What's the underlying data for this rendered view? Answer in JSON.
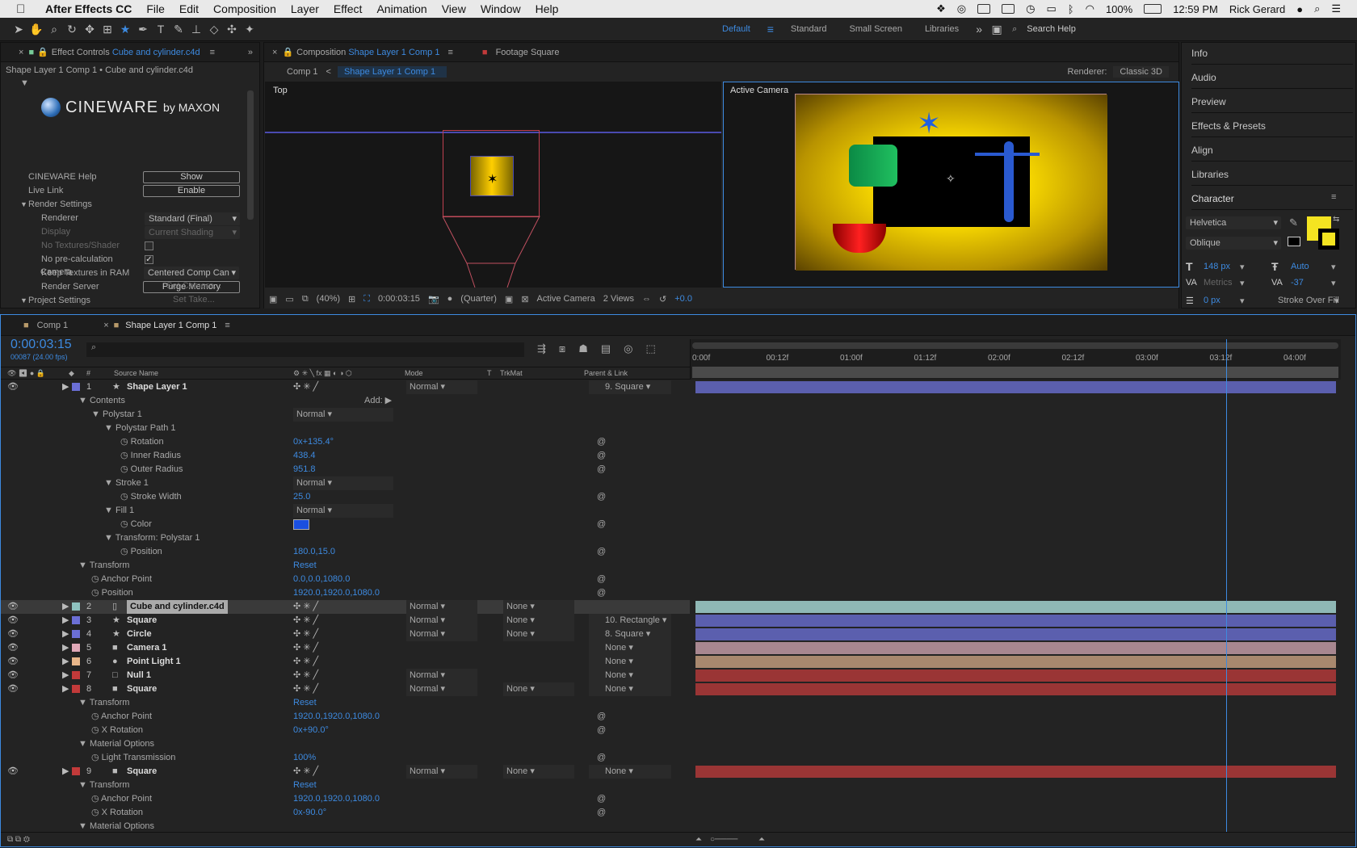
{
  "menubar": {
    "app_name": "After Effects CC",
    "items": [
      "File",
      "Edit",
      "Composition",
      "Layer",
      "Effect",
      "Animation",
      "View",
      "Window",
      "Help"
    ],
    "battery": "100%",
    "clock": "12:59 PM",
    "user": "Rick Gerard"
  },
  "toolbar": {
    "workspaces": [
      "Default",
      "Standard",
      "Small Screen",
      "Libraries"
    ],
    "active_workspace": "Default",
    "search_placeholder": "Search Help"
  },
  "effect_controls": {
    "tab_prefix": "Effect Controls",
    "tab_target": "Cube and cylinder.c4d",
    "breadcrumb": "Shape Layer 1 Comp 1 • Cube and cylinder.c4d",
    "brand": "CINEWARE",
    "brand_by": "by MAXON",
    "rows": {
      "help_label": "CINEWARE Help",
      "help_btn": "Show",
      "live_label": "Live Link",
      "live_btn": "Enable",
      "render_settings": "Render Settings",
      "renderer_label": "Renderer",
      "renderer_val": "Standard (Final)",
      "display_label": "Display",
      "display_val": "Current Shading",
      "no_tex_label": "No Textures/Shader",
      "no_precalc_label": "No pre-calculation",
      "keep_tex_label": "Keep Textures in RAM",
      "render_server_label": "Render Server",
      "render_server_btn": "Purge Memory",
      "project_settings": "Project Settings",
      "camera_label": "Camera",
      "camera_val": "Centered Comp Can",
      "set_camera": "Set Camera...",
      "set_take": "Set Take..."
    }
  },
  "composition": {
    "tab_prefix": "Composition",
    "tab_name": "Shape Layer 1 Comp 1",
    "footage_tab": "Footage Square",
    "crumb_1": "Comp 1",
    "crumb_2": "Shape Layer 1 Comp 1",
    "renderer_label": "Renderer:",
    "renderer_val": "Classic 3D",
    "view_left": "Top",
    "view_right": "Active Camera",
    "zoom": "(40%)",
    "timecode": "0:00:03:15",
    "resolution": "(Quarter)",
    "camera": "Active Camera",
    "views": "2 Views",
    "exposure": "+0.0"
  },
  "right_panel": {
    "items": [
      "Info",
      "Audio",
      "Preview",
      "Effects & Presets",
      "Align",
      "Libraries"
    ],
    "character": {
      "title": "Character",
      "font": "Helvetica",
      "style": "Oblique",
      "size": "148 px",
      "leading": "Auto",
      "kerning": "Metrics",
      "tracking": "-37",
      "stroke": "0 px",
      "stroke_mode": "Stroke Over Fill"
    }
  },
  "timeline": {
    "tabs": [
      "Comp 1",
      "Shape Layer 1 Comp 1"
    ],
    "timecode": "0:00:03:15",
    "frames": "00087 (24.00 fps)",
    "columns": {
      "hash": "#",
      "source": "Source Name",
      "mode": "Mode",
      "t": "T",
      "trkmat": "TrkMat",
      "parent": "Parent & Link"
    },
    "ruler": [
      "0:00f",
      "00:12f",
      "01:00f",
      "01:12f",
      "02:00f",
      "02:12f",
      "03:00f",
      "03:12f",
      "04:00f"
    ],
    "playhead_fraction": 0.828,
    "rows": [
      {
        "kind": "layer",
        "num": "1",
        "name": "Shape Layer 1",
        "color": "#6b6fd6",
        "mode": "Normal",
        "parent": "9. Square",
        "icon": "★",
        "bar": "#5b5fae"
      },
      {
        "kind": "group",
        "indent": 1,
        "name": "Contents",
        "extra": "Add:"
      },
      {
        "kind": "group",
        "indent": 2,
        "name": "Polystar 1",
        "mode": "Normal"
      },
      {
        "kind": "group",
        "indent": 3,
        "name": "Polystar Path 1"
      },
      {
        "kind": "prop",
        "indent": 4,
        "name": "Rotation",
        "value": "0x+135.4°"
      },
      {
        "kind": "prop",
        "indent": 4,
        "name": "Inner Radius",
        "value": "438.4"
      },
      {
        "kind": "prop",
        "indent": 4,
        "name": "Outer Radius",
        "value": "951.8"
      },
      {
        "kind": "group",
        "indent": 3,
        "name": "Stroke 1",
        "mode": "Normal"
      },
      {
        "kind": "prop",
        "indent": 4,
        "name": "Stroke Width",
        "value": "25.0"
      },
      {
        "kind": "group",
        "indent": 3,
        "name": "Fill 1",
        "mode": "Normal"
      },
      {
        "kind": "prop",
        "indent": 4,
        "name": "Color",
        "value": ""
      },
      {
        "kind": "group",
        "indent": 3,
        "name": "Transform: Polystar 1"
      },
      {
        "kind": "prop",
        "indent": 4,
        "name": "Position",
        "value": "180.0,15.0"
      },
      {
        "kind": "group",
        "indent": 1,
        "name": "Transform",
        "value": "Reset"
      },
      {
        "kind": "prop",
        "indent": 2,
        "name": "Anchor Point",
        "value": "0.0,0.0,1080.0"
      },
      {
        "kind": "prop",
        "indent": 2,
        "name": "Position",
        "value": "1920.0,1920.0,1080.0"
      },
      {
        "kind": "layer",
        "num": "2",
        "name": "Cube and cylinder.c4d",
        "color": "#8fc3c0",
        "mode": "Normal",
        "trkmat": "None",
        "parent": "",
        "icon": "▯",
        "bar": "#8fb8b5",
        "selected": true
      },
      {
        "kind": "layer",
        "num": "3",
        "name": "Square",
        "color": "#6b6fd6",
        "mode": "Normal",
        "trkmat": "None",
        "parent": "10. Rectangle",
        "icon": "★",
        "bar": "#5b5fae"
      },
      {
        "kind": "layer",
        "num": "4",
        "name": "Circle",
        "color": "#6b6fd6",
        "mode": "Normal",
        "trkmat": "None",
        "parent": "8. Square",
        "icon": "★",
        "bar": "#5b5fae"
      },
      {
        "kind": "layer",
        "num": "5",
        "name": "Camera 1",
        "color": "#e0a8b8",
        "mode": "",
        "parent": "None",
        "icon": "■",
        "bar": "#a88790"
      },
      {
        "kind": "layer",
        "num": "6",
        "name": "Point Light 1",
        "color": "#e8b68a",
        "mode": "",
        "parent": "None",
        "icon": "●",
        "bar": "#a8886e"
      },
      {
        "kind": "layer",
        "num": "7",
        "name": "Null 1",
        "color": "#c23a3a",
        "mode": "Normal",
        "parent": "None",
        "icon": "□",
        "bar": "#9a3535"
      },
      {
        "kind": "layer",
        "num": "8",
        "name": "Square",
        "color": "#c23a3a",
        "mode": "Normal",
        "trkmat": "None",
        "parent": "None",
        "icon": "■",
        "bar": "#9a3535"
      },
      {
        "kind": "group",
        "indent": 1,
        "name": "Transform",
        "value": "Reset"
      },
      {
        "kind": "prop",
        "indent": 2,
        "name": "Anchor Point",
        "value": "1920.0,1920.0,1080.0"
      },
      {
        "kind": "prop",
        "indent": 2,
        "name": "X Rotation",
        "value": "0x+90.0°"
      },
      {
        "kind": "group",
        "indent": 1,
        "name": "Material Options"
      },
      {
        "kind": "prop",
        "indent": 2,
        "name": "Light Transmission",
        "value": "100%"
      },
      {
        "kind": "layer",
        "num": "9",
        "name": "Square",
        "color": "#c23a3a",
        "mode": "Normal",
        "trkmat": "None",
        "parent": "None",
        "icon": "■",
        "bar": "#9a3535"
      },
      {
        "kind": "group",
        "indent": 1,
        "name": "Transform",
        "value": "Reset"
      },
      {
        "kind": "prop",
        "indent": 2,
        "name": "Anchor Point",
        "value": "1920.0,1920.0,1080.0"
      },
      {
        "kind": "prop",
        "indent": 2,
        "name": "X Rotation",
        "value": "0x-90.0°"
      },
      {
        "kind": "group",
        "indent": 1,
        "name": "Material Options"
      }
    ]
  },
  "colors": {
    "accent": "#3d8ae0",
    "fill_color": "#1a4fe0",
    "char_fill": "#f4e421"
  }
}
